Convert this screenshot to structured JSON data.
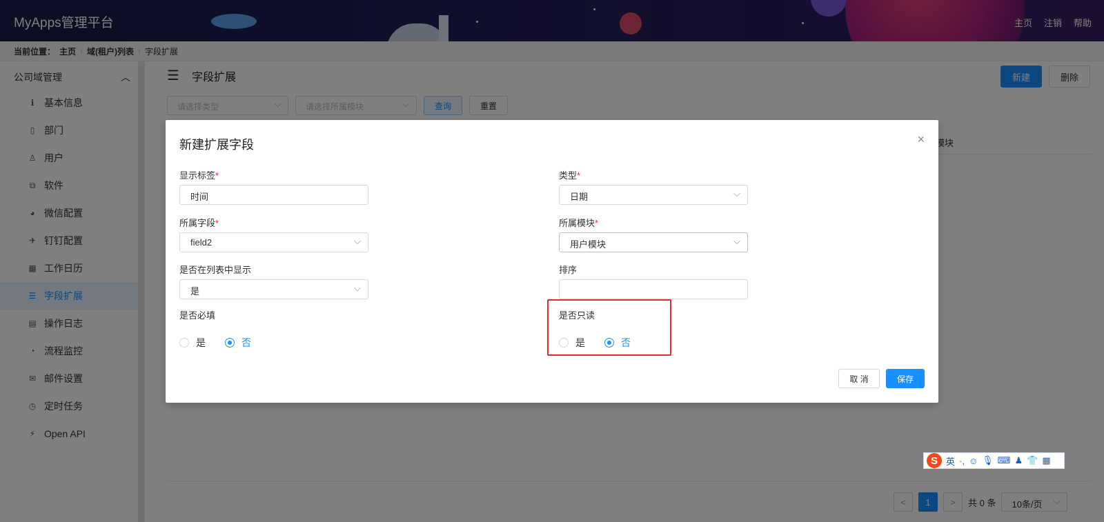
{
  "app": {
    "title": "MyApps管理平台"
  },
  "header_nav": [
    "主页",
    "注销",
    "帮助"
  ],
  "breadcrumb": {
    "prefix": "当前位置：",
    "items": [
      "主页",
      "域(租户)列表",
      "字段扩展"
    ]
  },
  "sidebar": {
    "group": "公司域管理",
    "items": [
      {
        "label": "基本信息",
        "icon": "info-icon",
        "glyph": "ℹ"
      },
      {
        "label": "部门",
        "icon": "building-icon",
        "glyph": "▯"
      },
      {
        "label": "用户",
        "icon": "user-icon",
        "glyph": "♙"
      },
      {
        "label": "软件",
        "icon": "cubes-icon",
        "glyph": "⧉"
      },
      {
        "label": "微信配置",
        "icon": "wechat-icon",
        "glyph": "◕"
      },
      {
        "label": "钉钉配置",
        "icon": "plane-icon",
        "glyph": "✈"
      },
      {
        "label": "工作日历",
        "icon": "calendar-icon",
        "glyph": "▦"
      },
      {
        "label": "字段扩展",
        "icon": "sliders-icon",
        "glyph": "☰"
      },
      {
        "label": "操作日志",
        "icon": "log-icon",
        "glyph": "▤"
      },
      {
        "label": "流程监控",
        "icon": "dashboard-icon",
        "glyph": "◔"
      },
      {
        "label": "邮件设置",
        "icon": "mail-icon",
        "glyph": "✉"
      },
      {
        "label": "定时任务",
        "icon": "clock-icon",
        "glyph": "◷"
      },
      {
        "label": "Open API",
        "icon": "plug-icon",
        "glyph": "⚡"
      }
    ],
    "active_index": 7
  },
  "page": {
    "title": "字段扩展",
    "new_label": "新建",
    "delete_label": "删除",
    "filter_type_placeholder": "请选择类型",
    "filter_module_placeholder": "请选择所属模块",
    "query_label": "查询",
    "reset_label": "重置",
    "column_hint": "模块"
  },
  "pagination": {
    "prev": "<",
    "current": "1",
    "next": ">",
    "total": "共 0 条",
    "page_size": "10条/页"
  },
  "dialog": {
    "title": "新建扩展字段",
    "close_glyph": "×",
    "fields": {
      "display_label": {
        "label": "显示标签",
        "value": "时间"
      },
      "type": {
        "label": "类型",
        "value": "日期"
      },
      "field": {
        "label": "所属字段",
        "value": "field2"
      },
      "module": {
        "label": "所属模块",
        "value": "用户模块"
      },
      "show_in_list": {
        "label": "是否在列表中显示",
        "value": "是"
      },
      "sort": {
        "label": "排序",
        "value": ""
      },
      "required": {
        "label": "是否必填",
        "yes": "是",
        "no": "否",
        "selected": "否"
      },
      "readonly": {
        "label": "是否只读",
        "yes": "是",
        "no": "否",
        "selected": "否"
      }
    },
    "required_mark": "*",
    "cancel_label": "取 消",
    "save_label": "保存"
  },
  "ime": {
    "logo": "S",
    "mode": "英",
    "icons": [
      "·,",
      "☺",
      "🎙",
      "⌨",
      "♟",
      "👕",
      "▦"
    ]
  },
  "colors": {
    "primary": "#1890ff",
    "header_bg": "#1a1a4a",
    "highlight": "#e32b2b"
  }
}
